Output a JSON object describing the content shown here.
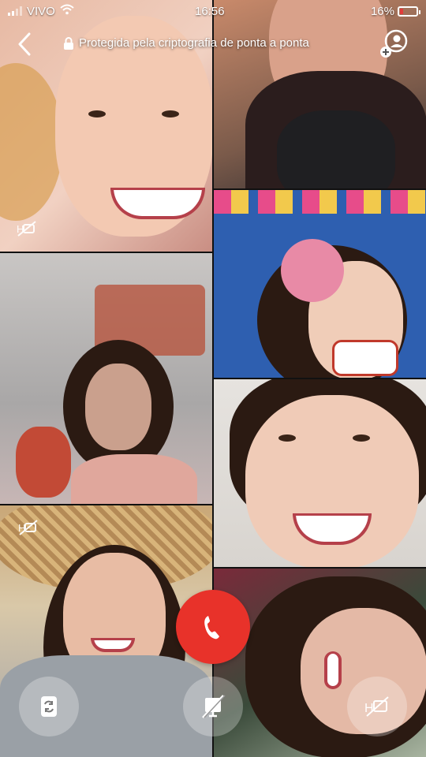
{
  "status_bar": {
    "carrier": "VIVO",
    "time": "16:56",
    "battery_percent": "16%",
    "battery_level": 0.16,
    "battery_color": "#e23b3b"
  },
  "top_bar": {
    "encryption_text": "Protegida pela criptografia de ponta a ponta",
    "back_icon": "chevron-left-icon",
    "add_icon": "add-participant-icon"
  },
  "participants": [
    {
      "tile": 1,
      "video_muted_icon": "video-off-icon"
    },
    {
      "tile": 2
    },
    {
      "tile": 3
    },
    {
      "tile": 4
    },
    {
      "tile": 5
    },
    {
      "tile": 6,
      "video_muted_icon": "video-off-icon"
    },
    {
      "tile": 7
    }
  ],
  "controls": {
    "switch_camera_icon": "camera-switch-icon",
    "end_call_icon": "phone-hangup-icon",
    "end_call_color": "#e8322a",
    "video_toggle_icon": "video-off-icon",
    "mute_icon": "mic-off-icon"
  }
}
